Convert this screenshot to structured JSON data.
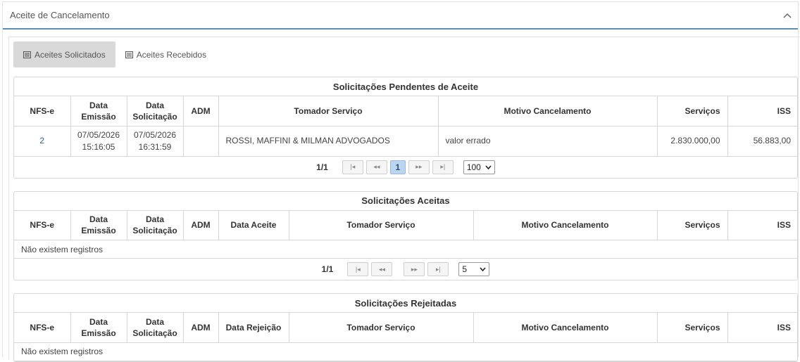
{
  "panel": {
    "title": "Aceite de Cancelamento"
  },
  "tabs": [
    {
      "label": "Aceites Solicitados",
      "active": true
    },
    {
      "label": "Aceites Recebidos",
      "active": false
    }
  ],
  "pendentes": {
    "title": "Solicitações Pendentes de Aceite",
    "columns": [
      "NFS-e",
      "Data Emissão",
      "Data Solicitação",
      "ADM",
      "Tomador Serviço",
      "Motivo Cancelamento",
      "Serviços",
      "ISS"
    ],
    "rows": [
      {
        "nfse": "2",
        "data_emissao": "07/05/2026",
        "hora_emissao": "15:16:05",
        "data_solicitacao": "07/05/2026",
        "hora_solicitacao": "16:31:59",
        "adm": "",
        "tomador": "ROSSI, MAFFINI & MILMAN ADVOGADOS",
        "motivo": "valor errado",
        "servicos": "2.830.000,00",
        "iss": "56.883,00"
      }
    ],
    "pager": {
      "info": "1/1",
      "current_page": "1",
      "page_size": "100"
    }
  },
  "aceitas": {
    "title": "Solicitações Aceitas",
    "columns": [
      "NFS-e",
      "Data Emissão",
      "Data Solicitação",
      "ADM",
      "Data Aceite",
      "Tomador Serviço",
      "Motivo Cancelamento",
      "Serviços",
      "ISS"
    ],
    "empty_text": "Não existem registros",
    "pager": {
      "info": "1/1",
      "page_size": "5"
    }
  },
  "rejeitadas": {
    "title": "Solicitações Rejeitadas",
    "columns": [
      "NFS-e",
      "Data Emissão",
      "Data Solicitação",
      "ADM",
      "Data Rejeição",
      "Tomador Serviço",
      "Motivo Cancelamento",
      "Serviços",
      "ISS"
    ],
    "empty_text": "Não existem registros"
  },
  "icons": {
    "collapse": "chevron-up-icon",
    "tab": "list-icon",
    "first": "first-page-icon",
    "prev": "prev-page-icon",
    "next": "next-page-icon",
    "last": "last-page-icon"
  },
  "colors": {
    "header_rule": "#5b8fb0",
    "active_tab": "#d9d9d9",
    "active_page": "#bcd5ef",
    "link": "#2a5d9f"
  }
}
